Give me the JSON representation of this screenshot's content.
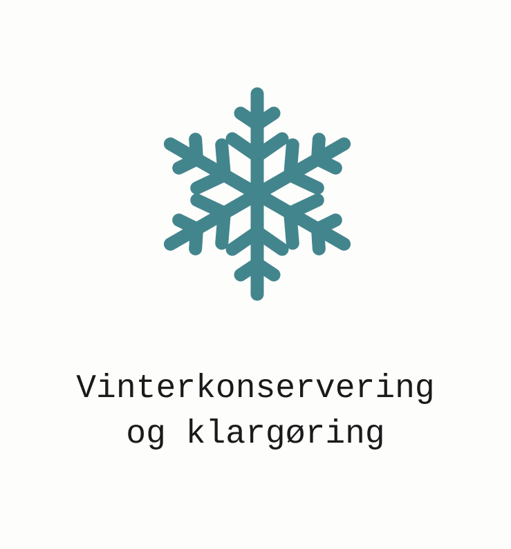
{
  "icon": {
    "name": "snowflake-icon",
    "color": "#43858d"
  },
  "title": {
    "line1": "Vinterkonservering",
    "line2": "og klargøring"
  },
  "colors": {
    "background": "#fdfdfb",
    "text": "#1a1a1a"
  }
}
